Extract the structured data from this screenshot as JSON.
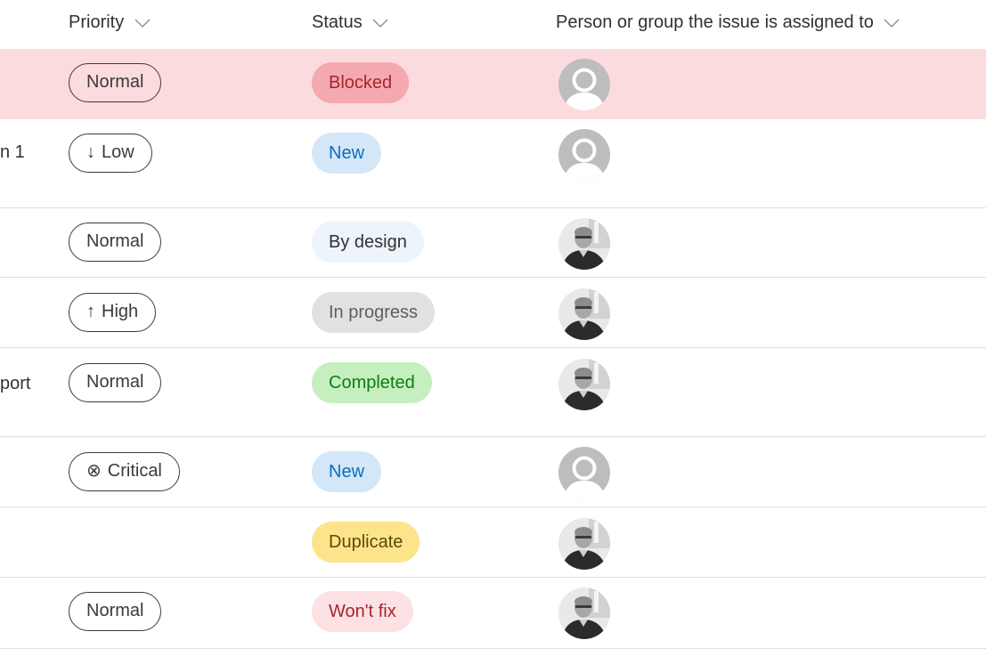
{
  "columns": {
    "priority": "Priority",
    "status": "Status",
    "assigned": "Person or group the issue is assigned to"
  },
  "rows": [
    {
      "title_fragment": "",
      "priority": "Normal",
      "priority_icon": "",
      "status": "Blocked",
      "status_bg": "#f4a9b1",
      "status_fg": "#a4262c",
      "avatar": "placeholder-avatar",
      "highlight": true
    },
    {
      "title_fragment": "n 1",
      "priority": "Low",
      "priority_icon": "↓",
      "status": "New",
      "status_bg": "#d3e7f8",
      "status_fg": "#0f6cbd",
      "avatar": "placeholder-avatar",
      "highlight": false
    },
    {
      "title_fragment": "",
      "priority": "Normal",
      "priority_icon": "",
      "status": "By design",
      "status_bg": "#edf4fc",
      "status_fg": "#323130",
      "avatar": "photo-avatar",
      "highlight": false
    },
    {
      "title_fragment": "",
      "priority": "High",
      "priority_icon": "↑",
      "status": "In progress",
      "status_bg": "#e1e1e1",
      "status_fg": "#605e5c",
      "avatar": "photo-avatar",
      "highlight": false
    },
    {
      "title_fragment": "port",
      "priority": "Normal",
      "priority_icon": "",
      "status": "Completed",
      "status_bg": "#c6efc0",
      "status_fg": "#107c10",
      "avatar": "photo-avatar",
      "highlight": false
    },
    {
      "title_fragment": "",
      "priority": "Critical",
      "priority_icon": "⊗",
      "status": "New",
      "status_bg": "#d3e7f8",
      "status_fg": "#0f6cbd",
      "avatar": "placeholder-avatar",
      "highlight": false
    },
    {
      "title_fragment": "",
      "priority": "",
      "priority_icon": "",
      "status": "Duplicate",
      "status_bg": "#fde48b",
      "status_fg": "#5c4a00",
      "avatar": "photo-avatar",
      "highlight": false
    },
    {
      "title_fragment": "",
      "priority": "Normal",
      "priority_icon": "",
      "status": "Won't fix",
      "status_bg": "#fde1e4",
      "status_fg": "#a4262c",
      "avatar": "photo-avatar",
      "highlight": false
    }
  ],
  "icons": {
    "sort": "chevron-down-icon",
    "low": "arrow-down-icon",
    "high": "arrow-up-icon",
    "critical": "circle-x-icon"
  }
}
